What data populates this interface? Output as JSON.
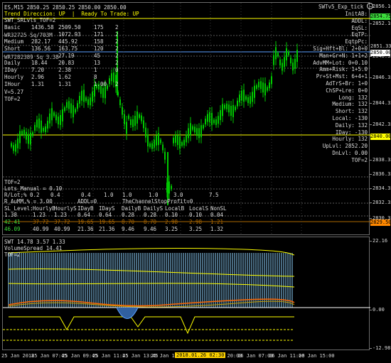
{
  "header": {
    "symbol_line": "ES,M15  2850.25 2850.25 2850.00 2850.00",
    "trend_label": "Trend Direccion:",
    "trend_value": "UP",
    "ready_label": "Ready To Trade:",
    "ready_value": "UP",
    "ea_name": "SWTv5_Exp_tick",
    "ea_icon": "smiley-icon"
  },
  "left_panel": {
    "title": "SWT_SRLvls_TOF=2",
    "overlay1": "WR32725 Sq/703M",
    "overlay2": "WR7282389 Sq 3.38",
    "rows": [
      [
        "Basic",
        "1436.58",
        "2509.50",
        "175",
        "2"
      ],
      [
        "",
        "",
        "1072.93",
        "171",
        "2"
      ],
      [
        "Medium",
        "282.17",
        "445.92",
        "158",
        "2"
      ],
      [
        "Short",
        "136.56",
        "163.75",
        "120",
        "2"
      ],
      [
        "",
        "",
        "27.19",
        "45",
        "2"
      ],
      [
        "Daily",
        "18.44",
        "20.83",
        "13",
        "2"
      ],
      [
        "IDay",
        "7.20",
        "2.38",
        "1",
        "0"
      ],
      [
        "Hourly",
        "2.96",
        "1.62",
        "8",
        ""
      ],
      [
        "IHour",
        "1.31",
        "1.31",
        "1.00",
        "2"
      ]
    ],
    "v_value": "V=5.27",
    "tof": "TOF=2"
  },
  "right_panel": [
    [
      "InitAB:",
      ""
    ],
    [
      "ADDL:",
      ""
    ],
    [
      "EqSL:",
      ""
    ],
    [
      "EqTP:",
      ""
    ],
    [
      "EqtpPc:",
      ""
    ],
    [
      "Sig+Hft+Bl:",
      "2+0+0"
    ],
    [
      "Man+Gr+N:",
      "1+1+2"
    ],
    [
      "AdvMM+Lot:",
      "0+0.10"
    ],
    [
      "Amm+Risk:",
      "1+5.0"
    ],
    [
      "Pr+St+Mst:",
      "6+4+1"
    ],
    [
      "AdTrS+Br:",
      "1+0"
    ],
    [
      "ChSP+Lre:",
      "0+0"
    ],
    [
      "Long:",
      "132"
    ],
    [
      "Medium:",
      "132"
    ],
    [
      "Short:",
      "132"
    ],
    [
      "Local:",
      "-130"
    ],
    [
      "Daily:",
      "132"
    ],
    [
      "IDay:",
      "-130"
    ],
    [
      "Hourly:",
      "132"
    ],
    [
      "UpLvl:",
      "2852.20"
    ],
    [
      "DnLvl:",
      "0.00"
    ],
    [
      "TOF=2",
      ""
    ]
  ],
  "bottom_panel": {
    "tof": "TOF=2",
    "lots": "Lots_Manual = 0.10",
    "rlots_label": "R/Lot;%",
    "rlots_values": [
      "0.2",
      "0.4",
      "0.4",
      "1.0",
      "1.0",
      "1.0",
      "3.0",
      "7.5"
    ],
    "r_aumm": "R_AuMM,% = 3.00",
    "addl": "ADDL=0",
    "channel_stop": "TheChannelStopProfit=0",
    "sl_header": [
      "SL_Level:",
      "HourlyB",
      "HourlyS",
      "IDayB",
      "IDayS",
      "DailyB",
      "DailyS",
      "LocalB",
      "LocalS",
      "NonSL"
    ],
    "sl_row1": [
      "1.38",
      "1.23",
      "1.23",
      "0.64",
      "0.64",
      "0.28",
      "0.28",
      "0.10",
      "0.10",
      "0.04"
    ],
    "sl_row2": [
      "42.41",
      "37.72",
      "37.72",
      "19.65",
      "19.65",
      "8.70",
      "8.70",
      "2.98",
      "2.98",
      "1.21"
    ],
    "sl_row3": [
      "46.09",
      "40.99",
      "40.99",
      "21.36",
      "21.36",
      "9.46",
      "9.46",
      "3.25",
      "3.25",
      "1.32"
    ]
  },
  "indicator": {
    "title": "SWT 14.78 3.57 1.33",
    "line2": "VolumeSpread 14.41",
    "tof": "TOF=2"
  },
  "price_axis": {
    "labels": [
      "2856.10",
      "2852.10",
      "2848.35",
      "2846.35",
      "2844.35",
      "2842.35",
      "2838.35",
      "2836.35",
      "2834.35",
      "2832.35",
      "2830.35"
    ],
    "boxes": [
      {
        "text": "2854.75",
        "bg": "#3cdc3c",
        "fg": "#000000"
      },
      {
        "text": "2851.33",
        "bg": "#000000",
        "fg": "#d8d8d8"
      },
      {
        "text": "2850.00",
        "bg": "#ffffff",
        "fg": "#000000"
      },
      {
        "text": "2840.00",
        "bg": "#ffff00",
        "fg": "#000000"
      },
      {
        "text": "2829.50",
        "bg": "#ff8800",
        "fg": "#000000"
      }
    ]
  },
  "sub_axis": {
    "labels": [
      "22.16",
      "0.00",
      "-12.98"
    ]
  },
  "time_axis": {
    "labels": [
      "25 Jan 2018",
      "25 Jan 07:45",
      "25 Jan 09:45",
      "25 Jan 11:45",
      "25 Jan 13:45",
      "25 Jan 15:45",
      "25 Jan 17:45",
      "25 Jan 20:00",
      "26 Jan 07:00",
      "26 Jan 11:00",
      "26 Jan 15:00"
    ],
    "highlight": "2018.01.26 02:30"
  },
  "colors": {
    "candle_up": "#00c800",
    "candle_down": "#00c800",
    "dotted_line": "#c8c8c8",
    "level_line": "#ffff00",
    "accent_blue": "#5aa0ff"
  }
}
